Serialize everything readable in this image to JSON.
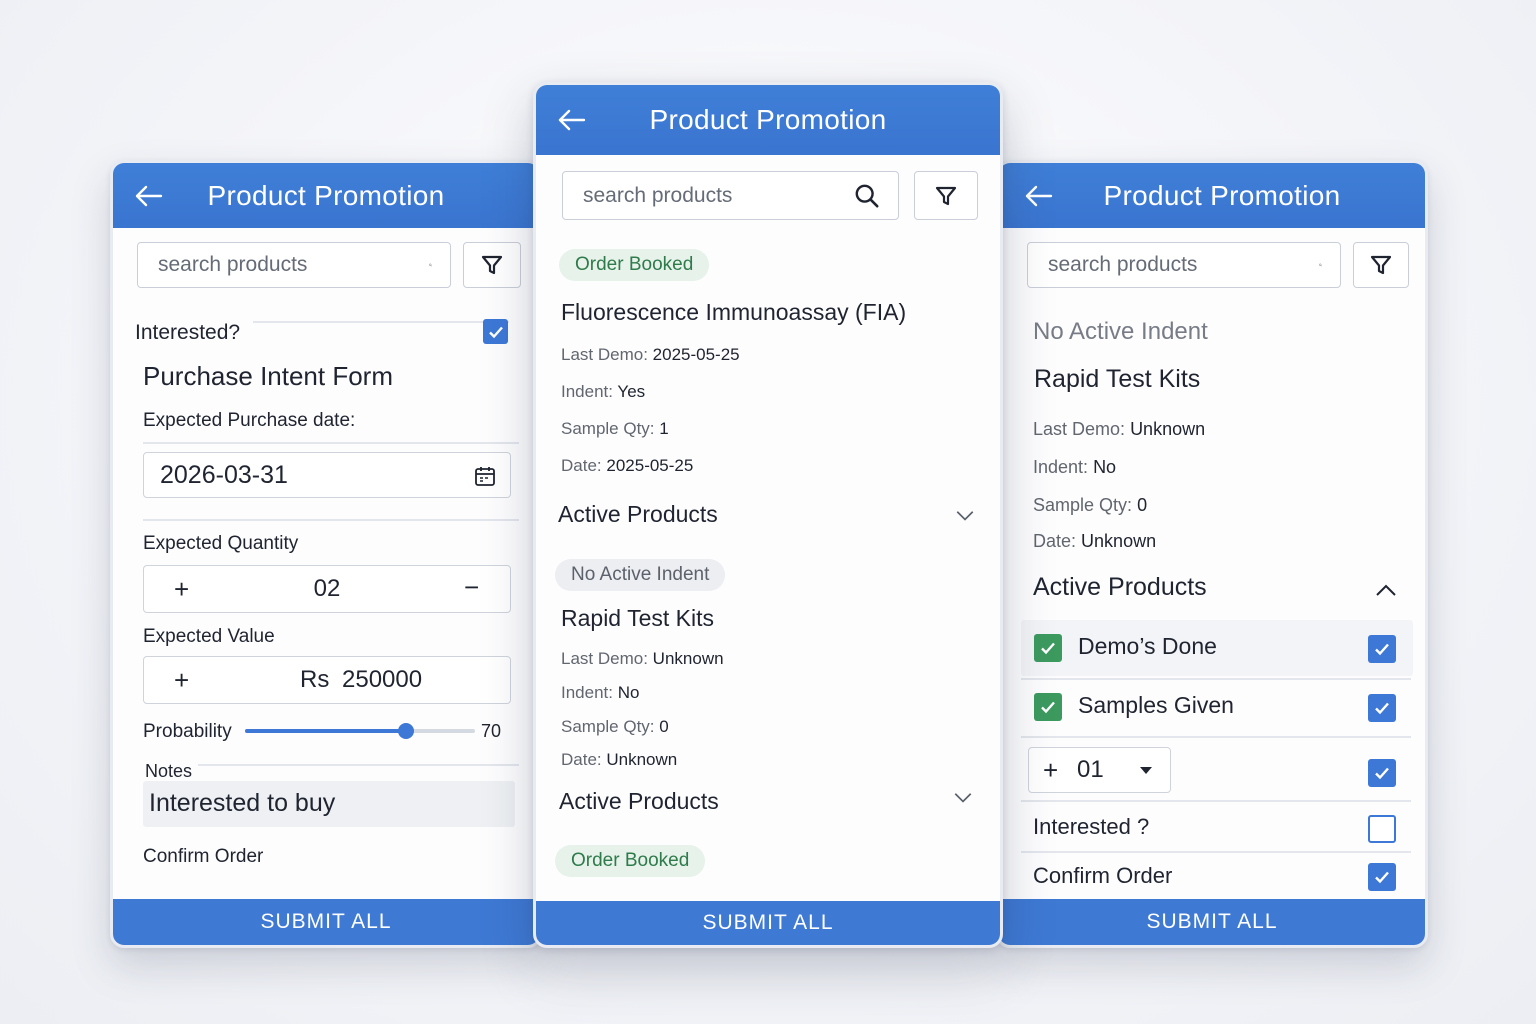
{
  "common": {
    "title": "Product Promotion",
    "search_placeholder": "search products",
    "submit_label": "SUBMIT ALL",
    "accent": "#3e79d4"
  },
  "left": {
    "interested_label": "Interested?",
    "interested_checked": true,
    "form_title": "Purchase Intent Form",
    "date_label": "Expected Purchase date:",
    "date_value": "2026-03-31",
    "qty_label": "Expected Quantity",
    "qty_plus": "+",
    "qty_value": "02",
    "qty_minus": "−",
    "value_label": "Expected Value",
    "value_plus": "+",
    "value_currency": "Rs",
    "value_amount": "250000",
    "probability_label": "Probability",
    "probability_value": "70",
    "probability_fraction": 0.7,
    "notes_label": "Notes",
    "notes_value": "Interested to buy",
    "confirm_label": "Confirm Order"
  },
  "center": {
    "cards": [
      {
        "badge": "Order Booked",
        "name": "Fluorescence Immunoassay (FIA)",
        "last_demo_label": "Last Demo:",
        "last_demo": "2025-05-25",
        "indent_label": "Indent:",
        "indent": "Yes",
        "sample_label": "Sample Qty:",
        "sample": "1",
        "date_label": "Date:",
        "date": "2025-05-25",
        "section": "Active Products"
      },
      {
        "badge": "No Active Indent",
        "name": "Rapid Test Kits",
        "last_demo_label": "Last Demo:",
        "last_demo": "Unknown",
        "indent_label": "Indent:",
        "indent": "No",
        "sample_label": "Sample Qty:",
        "sample": "0",
        "date_label": "Date:",
        "date": "Unknown",
        "section": "Active Products"
      },
      {
        "badge": "Order Booked"
      }
    ]
  },
  "right": {
    "status": "No Active Indent",
    "name": "Rapid Test Kits",
    "last_demo_label": "Last Demo:",
    "last_demo": "Unknown",
    "indent_label": "Indent:",
    "indent": "No",
    "sample_label": "Sample Qty:",
    "sample": "0",
    "date_label": "Date:",
    "date": "Unknown",
    "section": "Active Products",
    "items": [
      {
        "label": "Demo’s Done",
        "checked": true
      },
      {
        "label": "Samples Given",
        "checked": true
      }
    ],
    "stepper_plus": "+",
    "stepper_value": "01",
    "stepper_checked": true,
    "interested_label": "Interested ?",
    "interested_checked": false,
    "confirm_label": "Confirm Order",
    "confirm_checked": true
  }
}
